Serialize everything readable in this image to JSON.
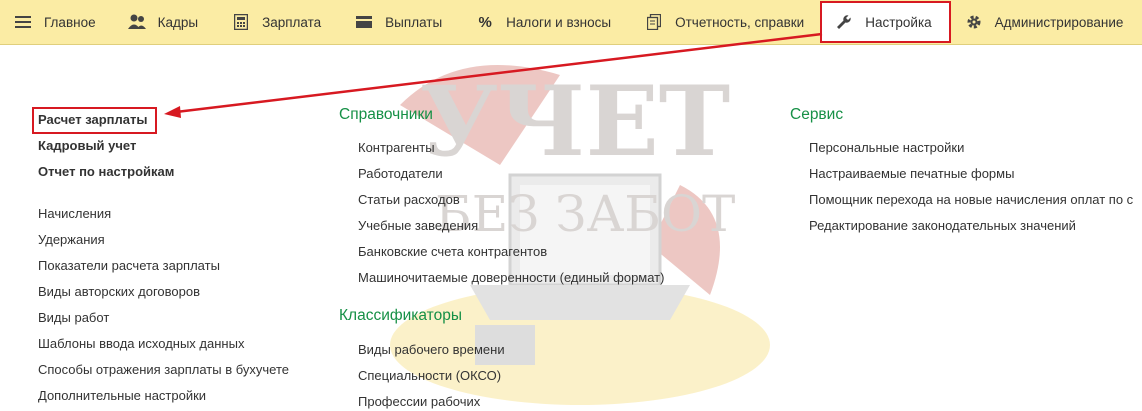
{
  "menu": {
    "items": [
      {
        "id": "main",
        "label": "Главное",
        "icon": "hamburger-icon"
      },
      {
        "id": "staff",
        "label": "Кадры",
        "icon": "people-icon"
      },
      {
        "id": "salary",
        "label": "Зарплата",
        "icon": "calculator-icon"
      },
      {
        "id": "payments",
        "label": "Выплаты",
        "icon": "wallet-icon"
      },
      {
        "id": "taxes",
        "label": "Налоги и взносы",
        "icon": "percent-icon"
      },
      {
        "id": "reports",
        "label": "Отчетность, справки",
        "icon": "documents-icon"
      },
      {
        "id": "settings",
        "label": "Настройка",
        "icon": "wrench-icon",
        "active": true
      },
      {
        "id": "admin",
        "label": "Администрирование",
        "icon": "gear-icon"
      }
    ]
  },
  "left": {
    "bold_links": [
      "Расчет зарплаты",
      "Кадровый учет",
      "Отчет по настройкам"
    ],
    "links": [
      "Начисления",
      "Удержания",
      "Показатели расчета зарплаты",
      "Виды авторских договоров",
      "Виды работ",
      "Шаблоны ввода исходных данных",
      "Способы отражения зарплаты в бухучете",
      "Дополнительные настройки"
    ]
  },
  "middle": {
    "directories_title": "Справочники",
    "directories": [
      "Контрагенты",
      "Работодатели",
      "Статьи расходов",
      "Учебные заведения",
      "Банковские счета контрагентов",
      "Машиночитаемые доверенности (единый формат)"
    ],
    "classifiers_title": "Классификаторы",
    "classifiers": [
      "Виды рабочего времени",
      "Специальности (ОКСО)",
      "Профессии рабочих"
    ]
  },
  "right": {
    "service_title": "Сервис",
    "service": [
      "Персональные настройки",
      "Настраиваемые печатные формы",
      "Помощник перехода на новые начисления оплат по с",
      "Редактирование законодательных значений"
    ]
  },
  "watermark": {
    "line1": "УЧЕТ",
    "line2": "БЕЗ ЗАБОТ"
  },
  "colors": {
    "menubar_bg": "#fbeca4",
    "highlight": "#d71921",
    "section_title": "#169046"
  }
}
